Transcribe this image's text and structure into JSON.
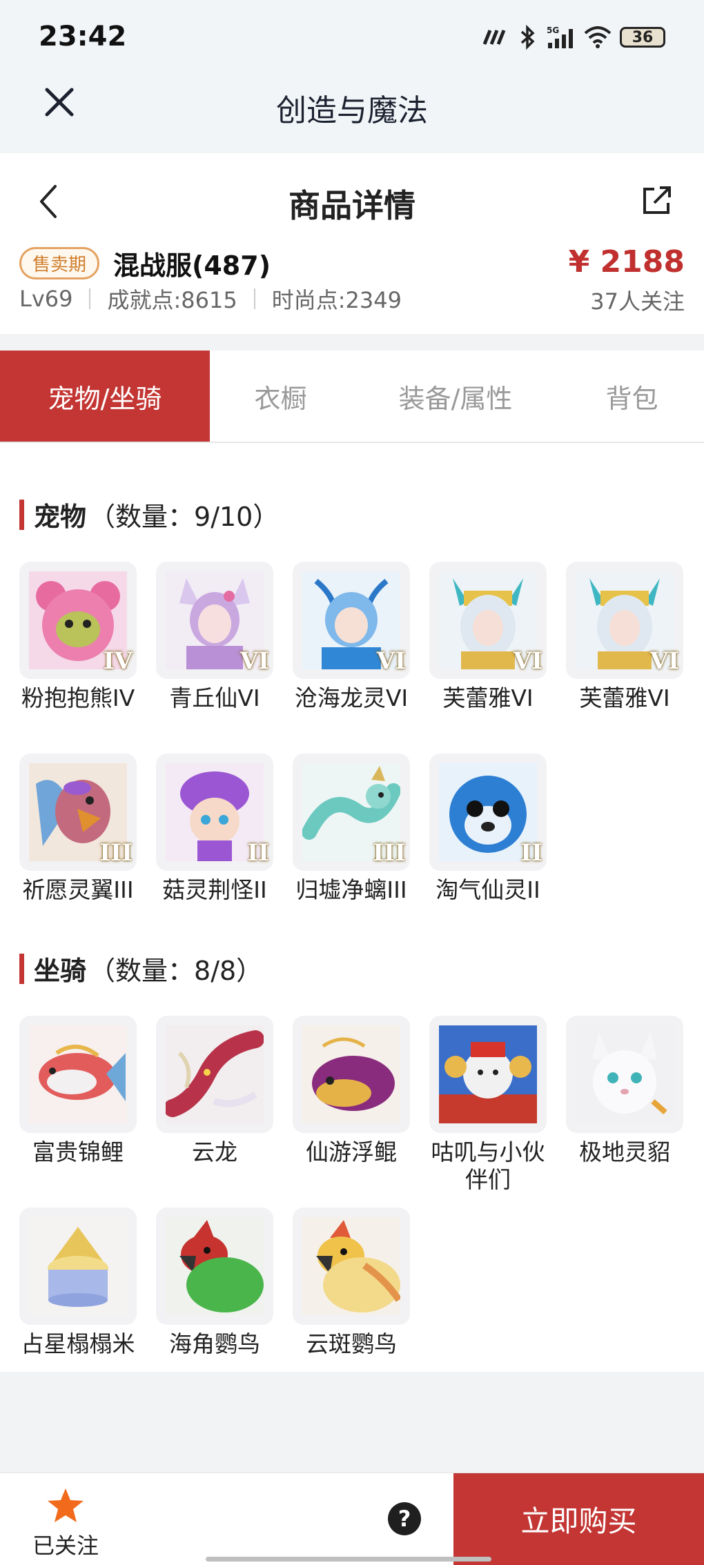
{
  "status": {
    "time": "23:42",
    "battery": "36",
    "network": "5G"
  },
  "app": {
    "title": "创造与魔法"
  },
  "nav": {
    "title": "商品详情"
  },
  "product": {
    "tag": "售卖期",
    "server": "混战服(487)",
    "price": "¥ 2188",
    "followers": "37人关注",
    "level": "Lv69",
    "achievement": "成就点:8615",
    "fashion": "时尚点:2349"
  },
  "tabs": [
    {
      "label": "宠物/坐骑",
      "active": true
    },
    {
      "label": "衣橱",
      "active": false
    },
    {
      "label": "装备/属性",
      "active": false
    },
    {
      "label": "背包",
      "active": false
    }
  ],
  "pets": {
    "title": "宠物",
    "count": "（数量：9/10）",
    "items": [
      {
        "name": "粉抱抱熊IV",
        "grade": "IV",
        "icon": "pink-bear-icon"
      },
      {
        "name": "青丘仙VI",
        "grade": "VI",
        "icon": "fox-fairy-icon"
      },
      {
        "name": "沧海龙灵VI",
        "grade": "VI",
        "icon": "dragon-spirit-icon"
      },
      {
        "name": "芙蕾雅VI",
        "grade": "VI",
        "icon": "freya-icon"
      },
      {
        "name": "芙蕾雅VI",
        "grade": "VI",
        "icon": "freya-icon"
      },
      {
        "name": "祈愿灵翼III",
        "grade": "III",
        "icon": "wish-wing-bird-icon"
      },
      {
        "name": "菇灵荆怪II",
        "grade": "II",
        "icon": "mushroom-sprite-icon"
      },
      {
        "name": "归墟净螭III",
        "grade": "III",
        "icon": "water-dragon-icon"
      },
      {
        "name": "淘气仙灵II",
        "grade": "II",
        "icon": "naughty-sprite-icon"
      }
    ]
  },
  "mounts": {
    "title": "坐骑",
    "count": "（数量：8/8）",
    "items": [
      {
        "name": "富贵锦鲤",
        "icon": "koi-fish-icon"
      },
      {
        "name": "云龙",
        "icon": "cloud-dragon-icon"
      },
      {
        "name": "仙游浮鲲",
        "icon": "floating-whale-icon"
      },
      {
        "name": "咕叽与小伙伴们",
        "icon": "guji-friends-icon"
      },
      {
        "name": "极地灵貂",
        "icon": "polar-marten-icon"
      },
      {
        "name": "占星榻榻米",
        "icon": "astrology-mat-icon"
      },
      {
        "name": "海角鹦鸟",
        "icon": "green-parrot-icon"
      },
      {
        "name": "云斑鹦鸟",
        "icon": "yellow-parrot-icon"
      }
    ]
  },
  "footer": {
    "follow_label": "已关注",
    "help": "?",
    "buy_label": "立即购买"
  },
  "colors": {
    "accent": "#c33634",
    "price": "#c0302f",
    "tag": "#e4a262"
  }
}
